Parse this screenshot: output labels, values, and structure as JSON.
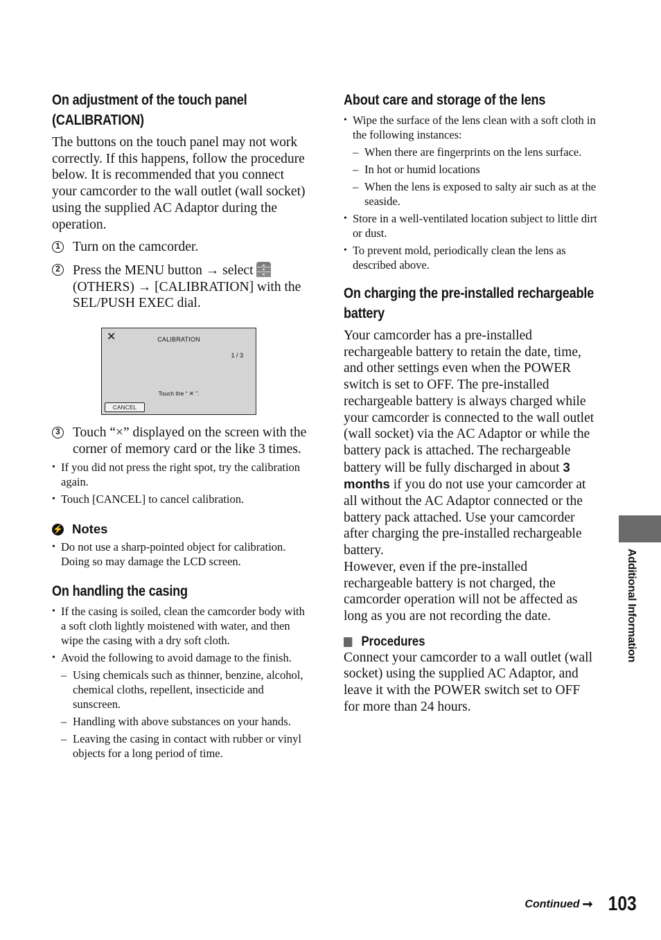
{
  "left_column": {
    "calibration": {
      "heading": "On adjustment of the touch panel (CALIBRATION)",
      "intro": "The buttons on the touch panel may not work correctly. If this happens, follow the procedure below. It is recommended that you connect your camcorder to the wall outlet (wall socket) using the supplied AC Adaptor during the operation.",
      "steps": [
        {
          "num": "1",
          "text": "Turn on the camcorder."
        },
        {
          "num": "2",
          "text_a": "Press the MENU button → select ",
          "icon": "others-menu-icon",
          "text_b": "(OTHERS) → [CALIBRATION] with the SEL/PUSH EXEC dial."
        },
        {
          "num": "3",
          "text": "Touch “×” displayed on the screen with the corner of memory card or the like 3 times."
        }
      ],
      "screen": {
        "close_glyph": "✕",
        "title": "CALIBRATION",
        "page": "1 / 3",
        "instruction": "Touch the “ ✕ ”.",
        "cancel_label": "CANCEL"
      },
      "step3_bullets": [
        "If you did not press the right spot, try the calibration again.",
        "Touch [CANCEL] to cancel calibration."
      ],
      "notes_label": "Notes",
      "notes": [
        "Do not use a sharp-pointed object for calibration. Doing so may damage the LCD screen."
      ]
    },
    "casing": {
      "heading": "On handling the casing",
      "bullets": [
        "If the casing is soiled, clean the camcorder body with a soft cloth lightly moistened with water, and then wipe the casing with a dry soft cloth.",
        "Avoid the following to avoid damage to the finish."
      ],
      "dashes": [
        "Using chemicals such as thinner, benzine, alcohol, chemical cloths, repellent, insecticide and sunscreen.",
        "Handling with above substances on your hands.",
        "Leaving the casing in contact with rubber or vinyl objects for a long period of time."
      ]
    }
  },
  "right_column": {
    "lens": {
      "heading": "About care and storage of the lens",
      "bullet1": "Wipe the surface of the lens clean with a soft cloth in the following instances:",
      "dashes": [
        "When there are fingerprints on the lens surface.",
        "In hot or humid locations",
        "When the lens is exposed to salty air such as at the seaside."
      ],
      "bullet2": "Store in a well-ventilated location subject to little dirt or dust.",
      "bullet3": "To prevent mold, periodically clean the lens as described above."
    },
    "battery": {
      "heading": "On charging the pre-installed rechargeable battery",
      "para_a": "Your camcorder has a pre-installed rechargeable battery to retain the date, time, and other settings even when the POWER switch is set to OFF. The pre-installed rechargeable battery is always charged while your camcorder is connected to the wall outlet (wall socket) via the AC Adaptor or while the battery pack is attached. The rechargeable battery will be fully discharged in about ",
      "emphasis": "3 months",
      "para_b": " if you do not use your camcorder at all without the AC Adaptor connected or the battery pack attached. Use your camcorder after charging the pre-installed rechargeable battery.",
      "para_c": "However, even if the pre-installed rechargeable battery is not charged, the camcorder operation will not be affected as long as you are not recording the date.",
      "procedures_label": "Procedures",
      "procedures_text": "Connect your camcorder to a wall outlet (wall socket) using the supplied AC Adaptor, and leave it with the POWER switch set to OFF for more than 24 hours."
    }
  },
  "side_tab": {
    "label": "Additional Information",
    "color": "#6b6b6b"
  },
  "footer": {
    "continued": "Continued",
    "arrow": "➞",
    "page_number": "103"
  }
}
